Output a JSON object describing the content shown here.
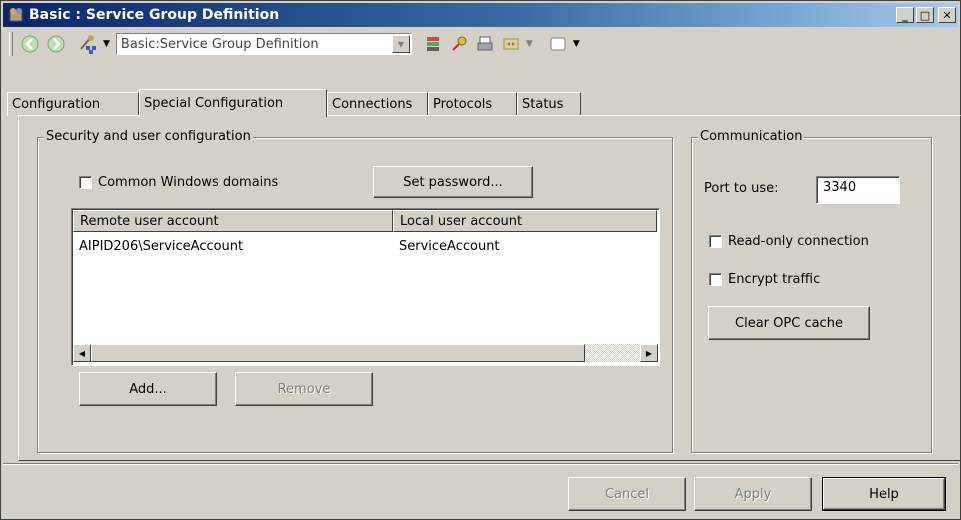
{
  "window": {
    "title": "Basic : Service Group Definition",
    "controls": {
      "minimize": "_",
      "maximize": "□",
      "close": "✕"
    }
  },
  "toolbar": {
    "combo_value": "Basic:Service Group Definition",
    "icons": [
      "back-icon",
      "forward-icon",
      "network-tool-icon",
      "stack-icon",
      "pin-icon",
      "print-icon",
      "filter-icon",
      "window-icon"
    ]
  },
  "tabs": [
    {
      "label": "Configuration"
    },
    {
      "label": "Special Configuration",
      "active": true
    },
    {
      "label": "Connections"
    },
    {
      "label": "Protocols"
    },
    {
      "label": "Status"
    }
  ],
  "security": {
    "legend": "Security and user configuration",
    "common_domains_label": "Common Windows domains",
    "common_domains_checked": false,
    "set_password_label": "Set password...",
    "list": {
      "columns": [
        "Remote user account",
        "Local user account"
      ],
      "rows": [
        {
          "remote": "AIPID206\\ServiceAccount",
          "local": "ServiceAccount"
        }
      ]
    },
    "add_label": "Add...",
    "remove_label": "Remove"
  },
  "communication": {
    "legend": "Communication",
    "port_label": "Port to use:",
    "port_value": "3340",
    "readonly_label": "Read-only connection",
    "readonly_checked": false,
    "encrypt_label": "Encrypt traffic",
    "encrypt_checked": false,
    "clear_cache_label": "Clear OPC cache"
  },
  "footer": {
    "cancel_label": "Cancel",
    "apply_label": "Apply",
    "help_label": "Help"
  }
}
